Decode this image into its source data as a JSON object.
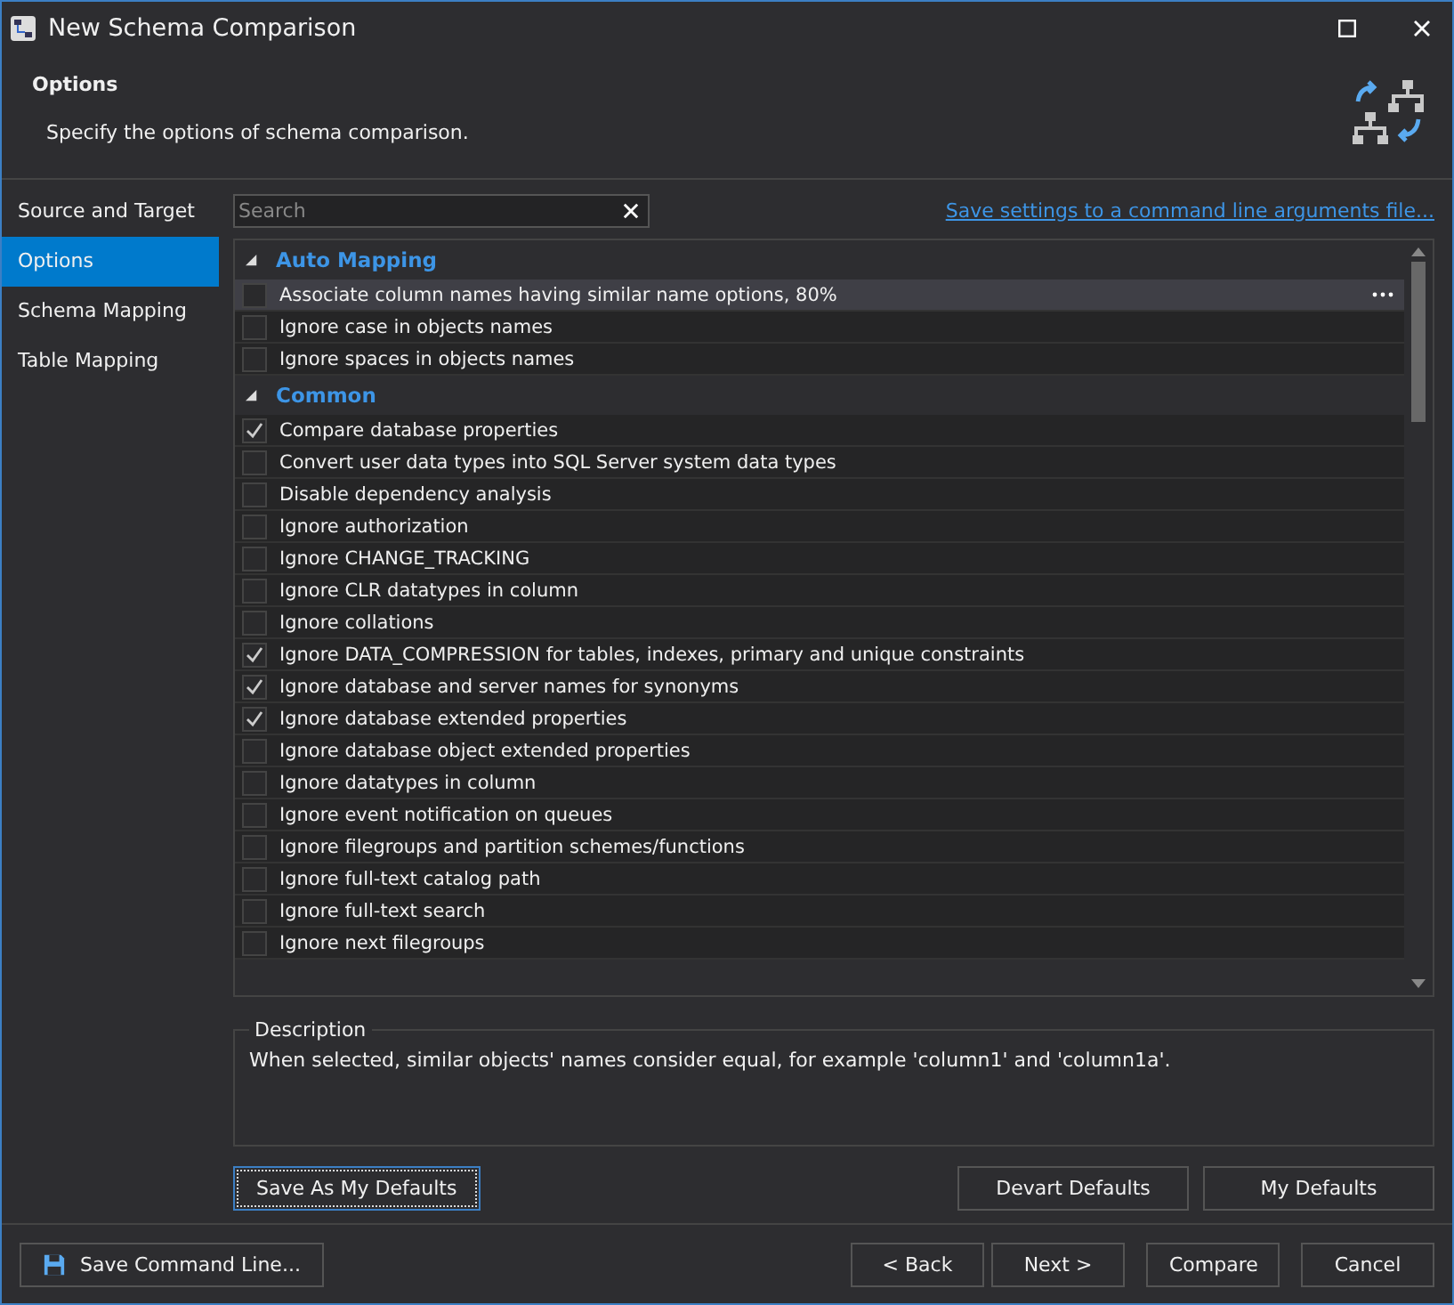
{
  "window": {
    "title": "New Schema Comparison"
  },
  "header": {
    "title": "Options",
    "subtitle": "Specify the options of schema comparison."
  },
  "sidebar": {
    "items": [
      {
        "label": "Source and Target",
        "selected": false
      },
      {
        "label": "Options",
        "selected": true
      },
      {
        "label": "Schema Mapping",
        "selected": false
      },
      {
        "label": "Table Mapping",
        "selected": false
      }
    ]
  },
  "search": {
    "placeholder": "Search"
  },
  "save_settings_link": "Save settings to a command line arguments file...",
  "option_groups": [
    {
      "title": "Auto Mapping",
      "expanded": true,
      "options": [
        {
          "label": "Associate column names having similar name options, 80%",
          "checked": false,
          "selected": true
        },
        {
          "label": "Ignore case in objects names",
          "checked": false,
          "selected": false
        },
        {
          "label": "Ignore spaces in objects names",
          "checked": false,
          "selected": false
        }
      ]
    },
    {
      "title": "Common",
      "expanded": true,
      "options": [
        {
          "label": "Compare database properties",
          "checked": true,
          "selected": false
        },
        {
          "label": "Convert user data types into SQL Server system data types",
          "checked": false,
          "selected": false
        },
        {
          "label": "Disable dependency analysis",
          "checked": false,
          "selected": false
        },
        {
          "label": "Ignore authorization",
          "checked": false,
          "selected": false
        },
        {
          "label": "Ignore CHANGE_TRACKING",
          "checked": false,
          "selected": false
        },
        {
          "label": "Ignore CLR datatypes in column",
          "checked": false,
          "selected": false
        },
        {
          "label": "Ignore collations",
          "checked": false,
          "selected": false
        },
        {
          "label": "Ignore DATA_COMPRESSION for tables, indexes, primary and unique constraints",
          "checked": true,
          "selected": false
        },
        {
          "label": "Ignore database and server names for synonyms",
          "checked": true,
          "selected": false
        },
        {
          "label": "Ignore database extended properties",
          "checked": true,
          "selected": false
        },
        {
          "label": "Ignore database object extended properties",
          "checked": false,
          "selected": false
        },
        {
          "label": "Ignore datatypes in column",
          "checked": false,
          "selected": false
        },
        {
          "label": "Ignore event notification on queues",
          "checked": false,
          "selected": false
        },
        {
          "label": "Ignore filegroups and partition schemes/functions",
          "checked": false,
          "selected": false
        },
        {
          "label": "Ignore full-text catalog path",
          "checked": false,
          "selected": false
        },
        {
          "label": "Ignore full-text search",
          "checked": false,
          "selected": false
        },
        {
          "label": "Ignore next filegroups",
          "checked": false,
          "selected": false
        }
      ]
    }
  ],
  "description": {
    "title": "Description",
    "text": "When selected, similar objects' names consider equal, for example 'column1' and 'column1a'."
  },
  "defaults_buttons": {
    "save": "Save As My Defaults",
    "devart": "Devart Defaults",
    "mine": "My Defaults"
  },
  "footer": {
    "save_command_line": "Save Command Line...",
    "buttons": [
      "< Back",
      "Next >",
      "Compare",
      "Cancel"
    ]
  }
}
